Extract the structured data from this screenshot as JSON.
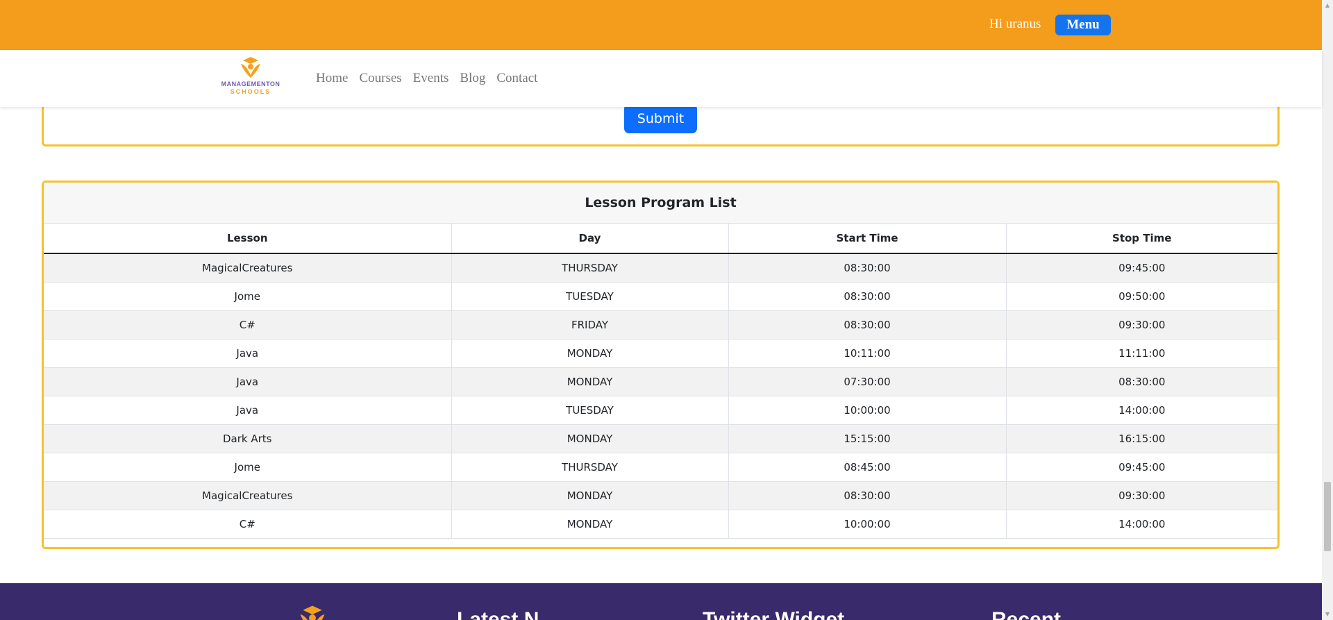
{
  "topbar": {
    "greeting": "Hi uranus",
    "menu_label": "Menu"
  },
  "logo": {
    "line1": "MANAGEMENTON",
    "line2": "SCHOOLS"
  },
  "nav": {
    "items": [
      "Home",
      "Courses",
      "Events",
      "Blog",
      "Contact"
    ]
  },
  "form": {
    "submit_label": "Submit"
  },
  "lesson_program": {
    "title": "Lesson Program List",
    "columns": [
      "Lesson",
      "Day",
      "Start Time",
      "Stop Time"
    ],
    "rows": [
      [
        "MagicalCreatures",
        "THURSDAY",
        "08:30:00",
        "09:45:00"
      ],
      [
        "Jome",
        "TUESDAY",
        "08:30:00",
        "09:50:00"
      ],
      [
        "C#",
        "FRIDAY",
        "08:30:00",
        "09:30:00"
      ],
      [
        "Java",
        "MONDAY",
        "10:11:00",
        "11:11:00"
      ],
      [
        "Java",
        "MONDAY",
        "07:30:00",
        "08:30:00"
      ],
      [
        "Java",
        "TUESDAY",
        "10:00:00",
        "14:00:00"
      ],
      [
        "Dark Arts",
        "MONDAY",
        "15:15:00",
        "16:15:00"
      ],
      [
        "Jome",
        "THURSDAY",
        "08:45:00",
        "09:45:00"
      ],
      [
        "MagicalCreatures",
        "MONDAY",
        "08:30:00",
        "09:30:00"
      ],
      [
        "C#",
        "MONDAY",
        "10:00:00",
        "14:00:00"
      ]
    ]
  },
  "footer": {
    "headings": [
      "Latest N",
      "Twitter Widget",
      "Recent"
    ]
  },
  "colors": {
    "topbar": "#f49c1b",
    "button_blue": "#0d6efd",
    "card_border": "#f5c12b",
    "footer": "#392a6b",
    "logo_purple": "#6f5bb5"
  }
}
